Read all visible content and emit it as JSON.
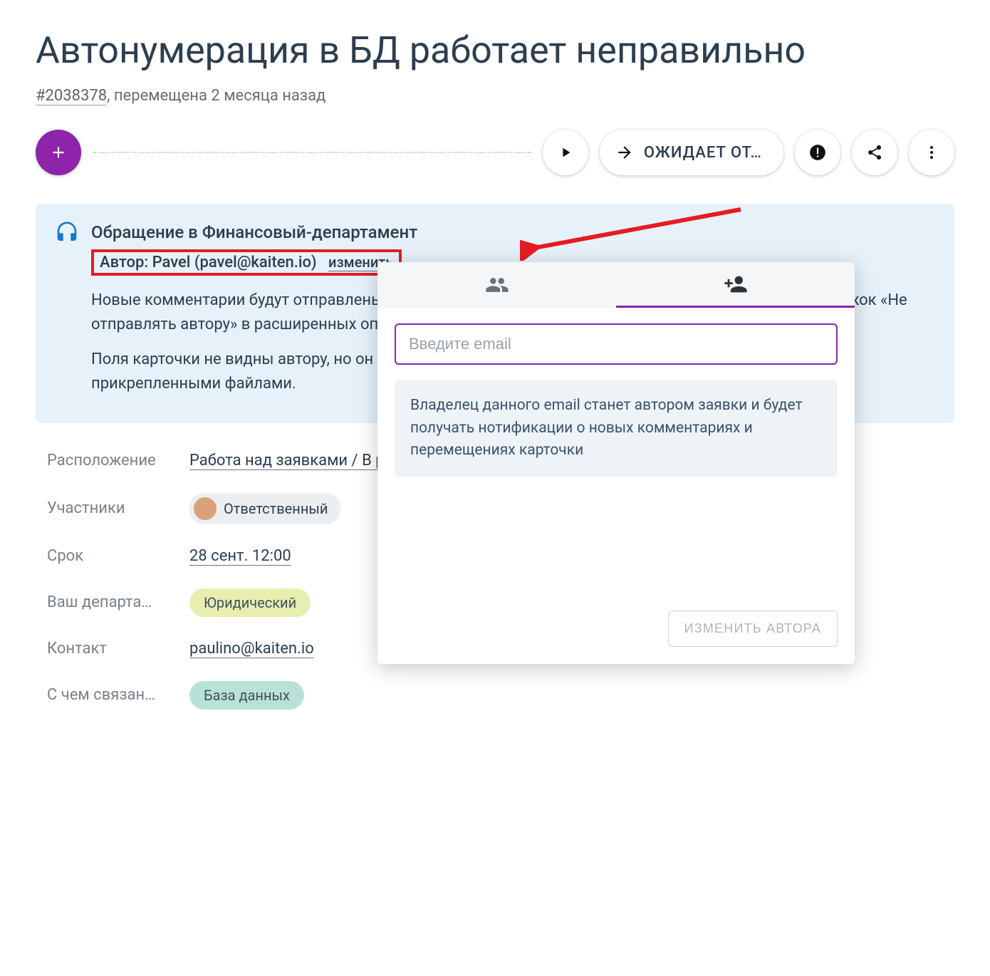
{
  "cardTitle": "Автонумерация в БД работает неправильно",
  "cardId": "#2038378",
  "movedText": "перемещена 2 месяца назад",
  "statusPill": "ОЖИДАЕТ ОТ…",
  "notice": {
    "title": "Обращение в Финансовый-департамент",
    "authorLabel": "Автор: Pavel (pavel@kaiten.io)",
    "changeLink": "изменить",
    "line1": "Новые комментарии будут отправлены на email автора. Вы можете отключить отправку, отметив флажок «Не отправлять автору» в расширенных опциях комментария.",
    "line2": "Поля карточки не видны автору, но он получит оповещения после перемещений и комментариев с прикрепленными файлами."
  },
  "fields": {
    "locationLabel": "Расположение",
    "locationValue": "Работа над заявками / В работе",
    "membersLabel": "Участники",
    "memberChip": "Ответственный",
    "dueLabel": "Срок",
    "dueValue": "28 сент. 12:00",
    "deptLabel": "Ваш департа…",
    "deptTag": "Юридический",
    "contactLabel": "Контакт",
    "contactValue": "paulino@kaiten.io",
    "relatedLabel": "С чем связан…",
    "relatedTag": "База данных"
  },
  "popup": {
    "emailPlaceholder": "Введите email",
    "infoText": "Владелец данного email станет автором заявки и будет получать нотификации о новых комментариях и перемещениях карточки",
    "changeButton": "ИЗМЕНИТЬ АВТОРА"
  }
}
